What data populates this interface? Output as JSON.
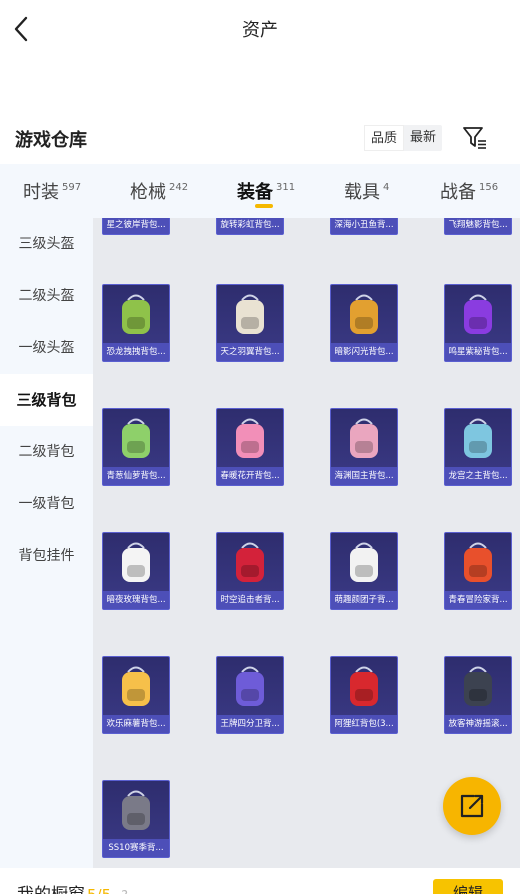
{
  "header": {
    "title": "资产"
  },
  "section": {
    "title": "游戏仓库",
    "sort_options": [
      "品质",
      "最新"
    ],
    "sort_active": "最新"
  },
  "tabs": [
    {
      "label": "时装",
      "count": "597"
    },
    {
      "label": "枪械",
      "count": "242"
    },
    {
      "label": "装备",
      "count": "311"
    },
    {
      "label": "载具",
      "count": "4"
    },
    {
      "label": "战备",
      "count": "156"
    }
  ],
  "sidebar": [
    {
      "label": "三级头盔"
    },
    {
      "label": "二级头盔"
    },
    {
      "label": "一级头盔"
    },
    {
      "label": "三级背包"
    },
    {
      "label": "二级背包"
    },
    {
      "label": "一级背包"
    },
    {
      "label": "背包挂件"
    }
  ],
  "items": [
    {
      "label": "星之彼岸背包...",
      "accent": "#6a74ff"
    },
    {
      "label": "旋转彩虹背包...",
      "accent": "#f3a0c8"
    },
    {
      "label": "深海小丑鱼背...",
      "accent": "#ff8a2a"
    },
    {
      "label": "飞翔魅影背包...",
      "accent": "#b35cff"
    },
    {
      "label": "恐龙拽拽背包...",
      "accent": "#8fc24a"
    },
    {
      "label": "天之羽翼背包...",
      "accent": "#e9e2d2"
    },
    {
      "label": "暗影闪光背包...",
      "accent": "#e2a030"
    },
    {
      "label": "鸣星紫秘背包...",
      "accent": "#8a3ce0"
    },
    {
      "label": "青葱仙萝背包...",
      "accent": "#8ed06a"
    },
    {
      "label": "春暖花开背包...",
      "accent": "#f28fb8"
    },
    {
      "label": "海渊国主背包...",
      "accent": "#eaa6bf"
    },
    {
      "label": "龙宫之主背包...",
      "accent": "#7ec6e0"
    },
    {
      "label": "暗夜玫瑰背包...",
      "accent": "#f4f4f4"
    },
    {
      "label": "时空追击者背...",
      "accent": "#d3223a"
    },
    {
      "label": "萌趣颜团子背...",
      "accent": "#f2f2f2"
    },
    {
      "label": "青春冒险家背...",
      "accent": "#e8502c"
    },
    {
      "label": "欢乐麻薯背包...",
      "accent": "#f6c04a"
    },
    {
      "label": "王牌四分卫背...",
      "accent": "#6e5cd8"
    },
    {
      "label": "阿狸红背包(3...",
      "accent": "#d8282e"
    },
    {
      "label": "放客神游摇滚...",
      "accent": "#3c4250"
    },
    {
      "label": "SS10赛季背...",
      "accent": "#7a7a88"
    }
  ],
  "bottom_bar": {
    "label": "我的橱窗",
    "count": "5/5",
    "help": "?",
    "edit_label": "编辑"
  }
}
